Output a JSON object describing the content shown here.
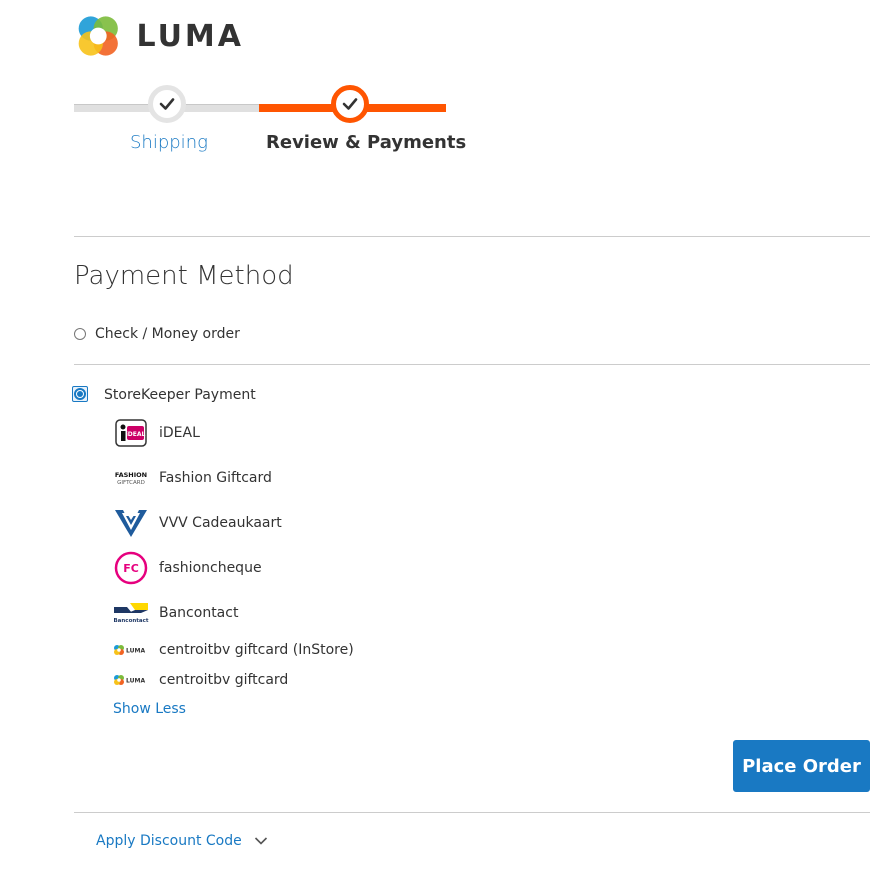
{
  "brand": {
    "name": "LUMA"
  },
  "progress": {
    "steps": [
      {
        "label": "Shipping",
        "state": "complete"
      },
      {
        "label": "Review & Payments",
        "state": "active"
      }
    ]
  },
  "payment": {
    "title": "Payment Method",
    "options": [
      {
        "label": "Check / Money order",
        "selected": false
      },
      {
        "label": "StoreKeeper Payment",
        "selected": true
      }
    ],
    "sub_methods": [
      {
        "label": "iDEAL",
        "icon": "ideal-icon"
      },
      {
        "label": "Fashion Giftcard",
        "icon": "fashion-giftcard-icon"
      },
      {
        "label": "VVV Cadeaukaart",
        "icon": "vvv-icon"
      },
      {
        "label": "fashioncheque",
        "icon": "fashioncheque-icon"
      },
      {
        "label": "Bancontact",
        "icon": "bancontact-icon"
      },
      {
        "label": "centroitbv giftcard (InStore)",
        "icon": "luma-icon"
      },
      {
        "label": "centroitbv giftcard",
        "icon": "luma-icon"
      }
    ],
    "show_less": "Show Less",
    "place_order": "Place Order"
  },
  "discount": {
    "label": "Apply Discount Code"
  },
  "icon_text": {
    "ideal": "iDEAL",
    "fashion_line1": "FASHION",
    "fashion_line2": "GIFTCARD",
    "fc": "FC",
    "bancontact": "Bancontact",
    "mini_luma": "LUMA"
  },
  "colors": {
    "accent": "#1979c3",
    "progress_active": "#ff5501",
    "progress_inactive": "#e0e0e0",
    "text": "#333333",
    "divider": "#cccccc"
  }
}
